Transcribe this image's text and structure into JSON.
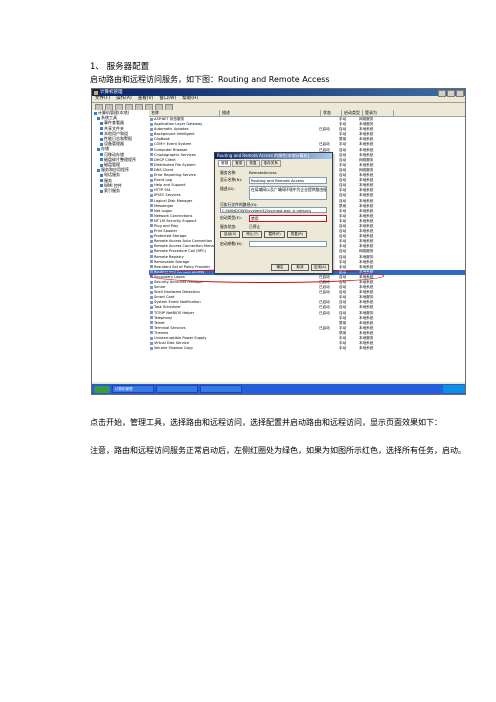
{
  "doc": {
    "heading": "1、 服务器配置",
    "intro": "启动路由和远程访问服务，如下图：Routing and Remote Access",
    "para1": "点击开始，管理工具，选择路由和远程访问，选择配置并启动路由和远程访问，显示页面效果如下：",
    "para2": "注意，路由和远程访问服务正常启动后，左侧红圈处为绿色，如果为如图所示红色，选择所有任务，启动。"
  },
  "screenshot": {
    "title": "计算机管理",
    "menu": [
      "文件(F)",
      "操作(A)",
      "查看(V)",
      "窗口(W)",
      "帮助(H)"
    ],
    "tree": [
      "计算机管理(本地)",
      "系统工具",
      "事件查看器",
      "共享文件夹",
      "本地用户和组",
      "性能日志和警报",
      "设备管理器",
      "存储",
      "可移动存储",
      "磁盘碎片整理程序",
      "磁盘管理",
      "服务和应用程序",
      "电话服务",
      "服务",
      "WMI 控件",
      "索引服务"
    ],
    "columns": [
      "名称",
      "描述",
      "状态",
      "启动类型",
      "登录为"
    ],
    "rows": [
      {
        "name": "ASP.NET 状态服务",
        "desc": "",
        "status": "",
        "start": "手动",
        "logon": "网络服务"
      },
      {
        "name": "Application Layer Gateway",
        "desc": "",
        "status": "",
        "start": "手动",
        "logon": "本地服务"
      },
      {
        "name": "Automatic Updates",
        "desc": "",
        "status": "已启动",
        "start": "自动",
        "logon": "本地系统"
      },
      {
        "name": "Background Intelligent",
        "desc": "",
        "status": "",
        "start": "手动",
        "logon": "本地系统"
      },
      {
        "name": "ClipBook",
        "desc": "",
        "status": "",
        "start": "禁用",
        "logon": "本地系统"
      },
      {
        "name": "COM+ Event System",
        "desc": "",
        "status": "已启动",
        "start": "手动",
        "logon": "本地系统"
      },
      {
        "name": "Computer Browser",
        "desc": "",
        "status": "已启动",
        "start": "自动",
        "logon": "本地系统"
      },
      {
        "name": "Cryptographic Services",
        "desc": "",
        "status": "已启动",
        "start": "自动",
        "logon": "本地系统"
      },
      {
        "name": "DHCP Client",
        "desc": "",
        "status": "已启动",
        "start": "自动",
        "logon": "网络服务"
      },
      {
        "name": "Distributed File System",
        "desc": "",
        "status": "",
        "start": "手动",
        "logon": "本地系统"
      },
      {
        "name": "DNS Client",
        "desc": "",
        "status": "已启动",
        "start": "自动",
        "logon": "网络服务"
      },
      {
        "name": "Error Reporting Service",
        "desc": "",
        "status": "已启动",
        "start": "自动",
        "logon": "本地系统"
      },
      {
        "name": "Event Log",
        "desc": "",
        "status": "已启动",
        "start": "自动",
        "logon": "本地系统"
      },
      {
        "name": "Help and Support",
        "desc": "",
        "status": "已启动",
        "start": "自动",
        "logon": "本地系统"
      },
      {
        "name": "HTTP SSL",
        "desc": "",
        "status": "",
        "start": "手动",
        "logon": "本地系统"
      },
      {
        "name": "IPSEC Services",
        "desc": "",
        "status": "已启动",
        "start": "自动",
        "logon": "本地系统"
      },
      {
        "name": "Logical Disk Manager",
        "desc": "",
        "status": "已启动",
        "start": "自动",
        "logon": "本地系统"
      },
      {
        "name": "Messenger",
        "desc": "",
        "status": "",
        "start": "禁用",
        "logon": "本地系统"
      },
      {
        "name": "Net Logon",
        "desc": "",
        "status": "",
        "start": "手动",
        "logon": "本地系统"
      },
      {
        "name": "Network Connections",
        "desc": "",
        "status": "已启动",
        "start": "手动",
        "logon": "本地系统"
      },
      {
        "name": "NT LM Security Support",
        "desc": "",
        "status": "",
        "start": "手动",
        "logon": "本地系统"
      },
      {
        "name": "Plug and Play",
        "desc": "",
        "status": "已启动",
        "start": "自动",
        "logon": "本地系统"
      },
      {
        "name": "Print Spooler",
        "desc": "",
        "status": "已启动",
        "start": "自动",
        "logon": "本地系统"
      },
      {
        "name": "Protected Storage",
        "desc": "",
        "status": "已启动",
        "start": "自动",
        "logon": "本地系统"
      },
      {
        "name": "Remote Access Auto Connection",
        "desc": "",
        "status": "",
        "start": "手动",
        "logon": "本地系统"
      },
      {
        "name": "Remote Access Connection Manager",
        "desc": "",
        "status": "",
        "start": "手动",
        "logon": "本地系统"
      },
      {
        "name": "Remote Procedure Call (RPC)",
        "desc": "",
        "status": "已启动",
        "start": "自动",
        "logon": "网络服务"
      },
      {
        "name": "Remote Registry",
        "desc": "",
        "status": "已启动",
        "start": "自动",
        "logon": "本地服务"
      },
      {
        "name": "Removable Storage",
        "desc": "",
        "status": "",
        "start": "手动",
        "logon": "本地系统"
      },
      {
        "name": "Resultant Set of Policy Provider",
        "desc": "",
        "status": "",
        "start": "手动",
        "logon": "本地系统"
      },
      {
        "name": "Routing and Remote Access",
        "desc": "",
        "status": "",
        "start": "禁用",
        "logon": "本地系统",
        "highlight": true
      },
      {
        "name": "Secondary Logon",
        "desc": "",
        "status": "已启动",
        "start": "自动",
        "logon": "本地系统"
      },
      {
        "name": "Security Accounts Manager",
        "desc": "",
        "status": "已启动",
        "start": "自动",
        "logon": "本地系统"
      },
      {
        "name": "Server",
        "desc": "",
        "status": "已启动",
        "start": "自动",
        "logon": "本地系统"
      },
      {
        "name": "Shell Hardware Detection",
        "desc": "",
        "status": "已启动",
        "start": "自动",
        "logon": "本地系统"
      },
      {
        "name": "Smart Card",
        "desc": "",
        "status": "",
        "start": "手动",
        "logon": "本地服务"
      },
      {
        "name": "System Event Notification",
        "desc": "",
        "status": "已启动",
        "start": "自动",
        "logon": "本地系统"
      },
      {
        "name": "Task Scheduler",
        "desc": "",
        "status": "已启动",
        "start": "自动",
        "logon": "本地系统"
      },
      {
        "name": "TCP/IP NetBIOS Helper",
        "desc": "",
        "status": "已启动",
        "start": "自动",
        "logon": "本地服务"
      },
      {
        "name": "Telephony",
        "desc": "",
        "status": "",
        "start": "手动",
        "logon": "本地系统"
      },
      {
        "name": "Telnet",
        "desc": "",
        "status": "",
        "start": "禁用",
        "logon": "本地系统"
      },
      {
        "name": "Terminal Services",
        "desc": "",
        "status": "已启动",
        "start": "手动",
        "logon": "本地系统"
      },
      {
        "name": "Themes",
        "desc": "",
        "status": "",
        "start": "禁用",
        "logon": "本地系统"
      },
      {
        "name": "Uninterruptible Power Supply",
        "desc": "",
        "status": "",
        "start": "手动",
        "logon": "本地服务"
      },
      {
        "name": "Virtual Disk Service",
        "desc": "",
        "status": "",
        "start": "手动",
        "logon": "本地系统"
      },
      {
        "name": "Volume Shadow Copy",
        "desc": "",
        "status": "",
        "start": "手动",
        "logon": "本地系统"
      }
    ],
    "dialog": {
      "title": "Routing and Remote Access 的属性(本地计算机)",
      "tabs": [
        "常规",
        "登录",
        "恢复",
        "依存关系"
      ],
      "service_name_label": "服务名称:",
      "service_name": "RemoteAccess",
      "display_name_label": "显示名称(N):",
      "display_name": "Routing and Remote Access",
      "desc_label": "描述(D):",
      "desc": "在局域网以及广域网环境中为企业提供路由服务。",
      "path_label": "可执行文件的路径(H):",
      "path": "C:\\WINDOWS\\system32\\svchost.exe -k netsvcs",
      "startup_label": "启动类型(E):",
      "startup": "禁用",
      "status_label": "服务状态:",
      "status": "已停止",
      "buttons": [
        "启动(S)",
        "停止(T)",
        "暂停(P)",
        "恢复(R)"
      ],
      "params_label": "启动参数(M):",
      "footer": [
        "确定",
        "取消",
        "应用(A)"
      ]
    },
    "taskbar": [
      "开始",
      "计算机管理",
      "",
      "",
      ""
    ],
    "clock": ""
  }
}
